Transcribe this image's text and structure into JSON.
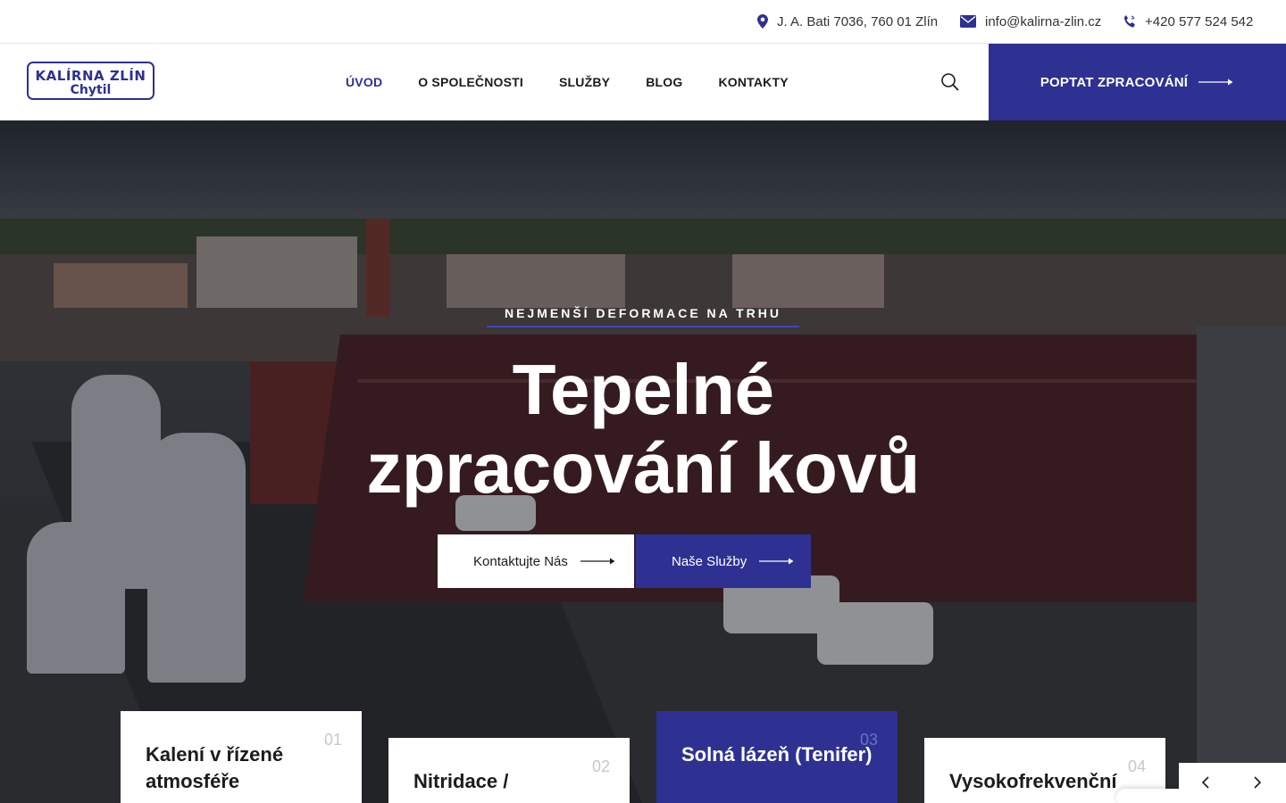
{
  "topbar": {
    "address": "J. A. Bati 7036, 760 01 Zlín",
    "email": "info@kalirna-zlin.cz",
    "phone": "+420 577 524 542"
  },
  "logo": {
    "line1": "KALÍRNA ZLÍN",
    "line2": "Chytil"
  },
  "nav": {
    "items": [
      {
        "label": "ÚVOD",
        "active": true
      },
      {
        "label": "O SPOLEČNOSTI",
        "active": false
      },
      {
        "label": "SLUŽBY",
        "active": false
      },
      {
        "label": "BLOG",
        "active": false
      },
      {
        "label": "KONTAKTY",
        "active": false
      }
    ]
  },
  "header": {
    "cta_label": "POPTAT ZPRACOVÁNÍ"
  },
  "hero": {
    "eyebrow": "NEJMENŠÍ DEFORMACE NA TRHU",
    "title_line1": "Tepelné",
    "title_line2": "zpracování kovů",
    "btn_contact": "Kontaktujte Nás",
    "btn_services": "Naše Služby"
  },
  "services": [
    {
      "num": "01",
      "title_line1": "Kalení v řízené",
      "title_line2": "atmosféře"
    },
    {
      "num": "02",
      "title_line1": "Nitridace /",
      "title_line2": ""
    },
    {
      "num": "03",
      "title_line1": "Solná lázeň (Tenifer)",
      "title_line2": ""
    },
    {
      "num": "04",
      "title_line1": "Vysokofrekvenční",
      "title_line2": ""
    }
  ],
  "colors": {
    "accent": "#2e3192",
    "text": "#1b1b1b"
  },
  "icons": [
    "location-pin-icon",
    "envelope-icon",
    "phone-icon",
    "search-icon",
    "arrow-right-icon",
    "chevron-left-icon",
    "chevron-right-icon"
  ]
}
